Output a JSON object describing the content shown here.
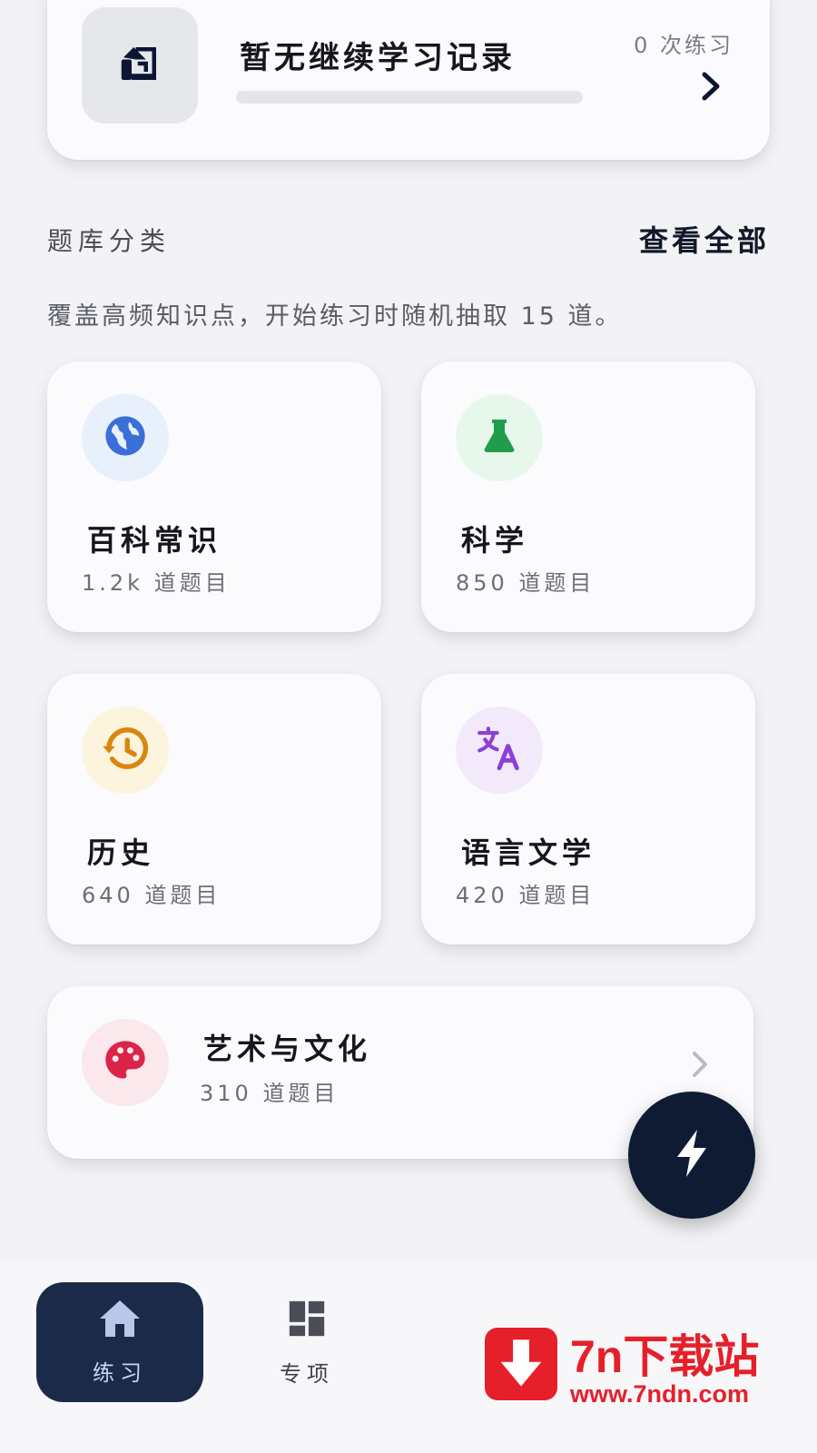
{
  "continue_card": {
    "title": "暂无继续学习记录",
    "count_label": "0 次练习",
    "progress": 0,
    "thumb_icon": "exit-icon",
    "chevron_icon": "chevron-right-icon"
  },
  "section": {
    "title": "题库分类",
    "view_all": "查看全部",
    "description": "覆盖高频知识点，开始练习时随机抽取 15 道。"
  },
  "categories": [
    {
      "name": "百科常识",
      "count": "1.2k 道题目",
      "icon": "globe-icon",
      "color": "#3a6fd8",
      "bg": "#e8f0fc"
    },
    {
      "name": "科学",
      "count": "850 道题目",
      "icon": "flask-icon",
      "color": "#1f9d4c",
      "bg": "#e8f7ec"
    },
    {
      "name": "历史",
      "count": "640 道题目",
      "icon": "history-icon",
      "color": "#d9860f",
      "bg": "#fdf4de"
    },
    {
      "name": "语言文学",
      "count": "420 道题目",
      "icon": "translate-icon",
      "color": "#8e3fd6",
      "bg": "#f2eafb"
    },
    {
      "name": "艺术与文化",
      "count": "310 道题目",
      "icon": "palette-icon",
      "color": "#dc2348",
      "bg": "#fbe8ec"
    }
  ],
  "fab": {
    "icon": "lightning-icon"
  },
  "bottom_nav": {
    "items": [
      {
        "label": "练习",
        "icon": "home-icon",
        "active": true
      },
      {
        "label": "专项",
        "icon": "grid-icon",
        "active": false
      }
    ]
  },
  "watermark": {
    "name": "7n下载站",
    "url": "www.7ndn.com"
  }
}
